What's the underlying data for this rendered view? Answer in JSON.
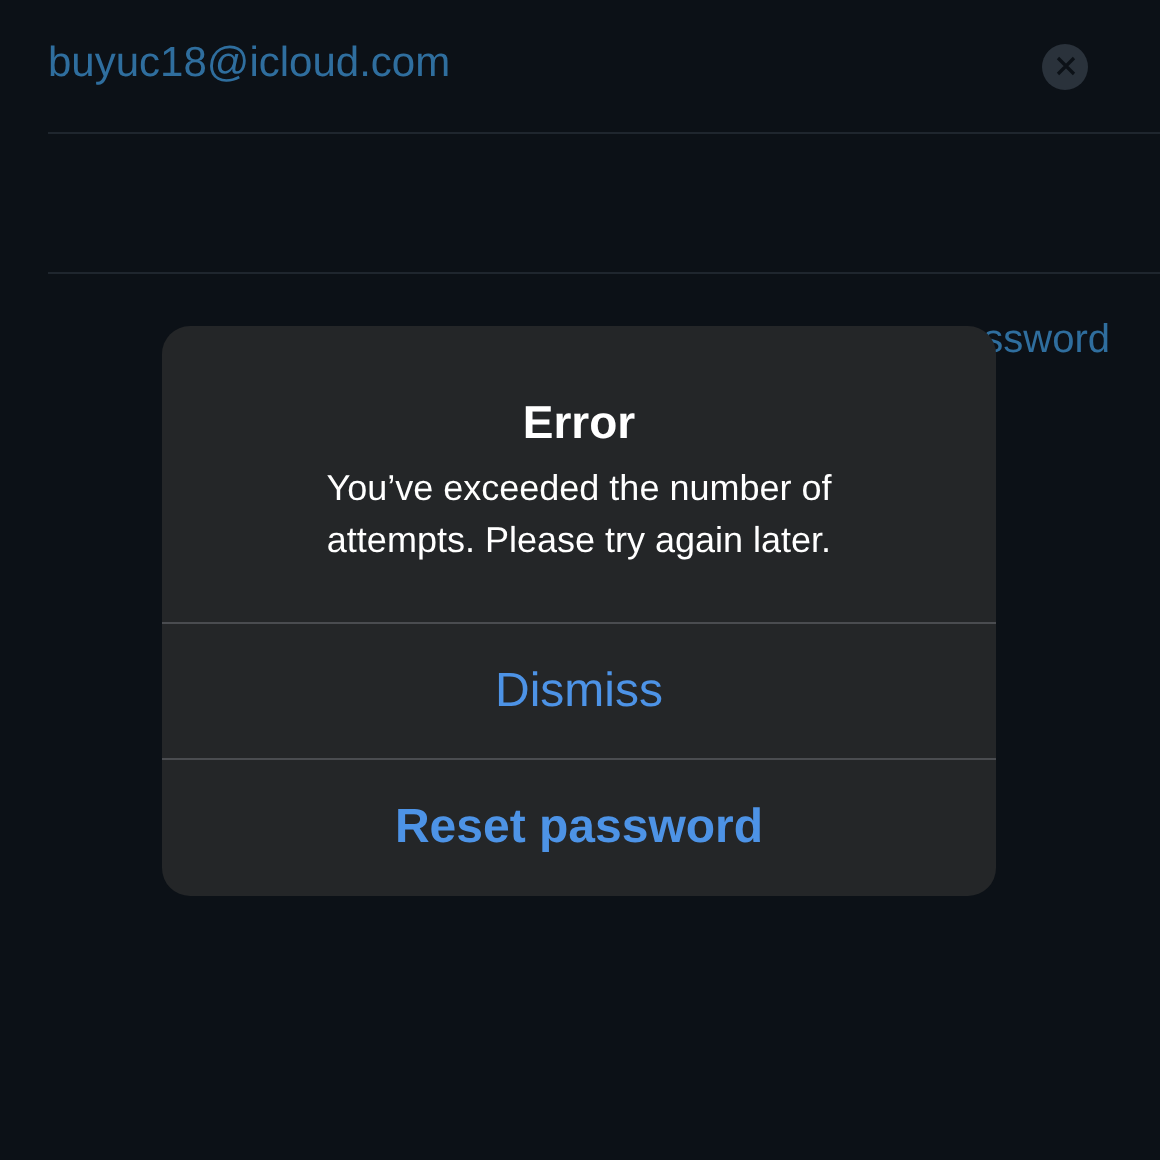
{
  "email_field": {
    "value": "buyuc18@icloud.com"
  },
  "forgot_link": {
    "label": "ssword"
  },
  "alert": {
    "title": "Error",
    "message": "You’ve exceeded the number of attempts. Please try again later.",
    "actions": [
      {
        "label": "Dismiss",
        "kind": "normal"
      },
      {
        "label": "Reset password",
        "kind": "preferred"
      }
    ]
  }
}
